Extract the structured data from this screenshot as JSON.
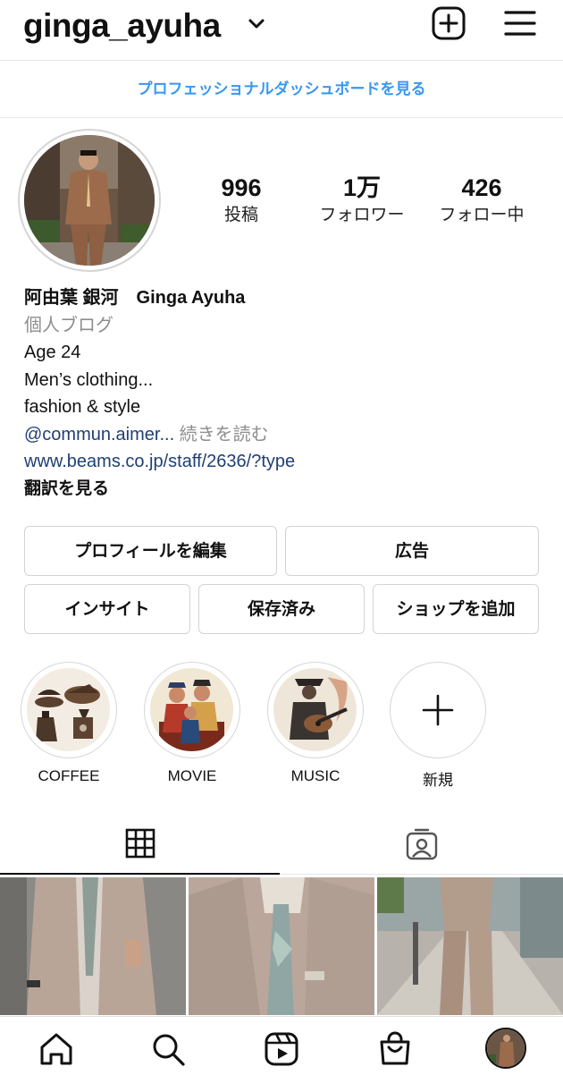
{
  "header": {
    "username": "ginga_ayuha"
  },
  "pro_dashboard_link": "プロフェッショナルダッシュボードを見る",
  "stats": [
    {
      "value": "996",
      "label": "投稿"
    },
    {
      "value": "1万",
      "label": "フォロワー"
    },
    {
      "value": "426",
      "label": "フォロー中"
    }
  ],
  "bio": {
    "name": "阿由葉 銀河　Ginga Ayuha",
    "category": "個人ブログ",
    "lines": [
      "Age 24",
      "Men’s clothing...",
      "fashion & style"
    ],
    "mention": "@commun.aimer...",
    "more": " 続きを読む",
    "url": "www.beams.co.jp/staff/2636/?type",
    "translate": "翻訳を見る"
  },
  "buttons": {
    "edit_profile": "プロフィールを編集",
    "ads": "広告",
    "insights": "インサイト",
    "saved": "保存済み",
    "add_shop": "ショップを追加"
  },
  "highlights": [
    {
      "label": "COFFEE"
    },
    {
      "label": "MOVIE"
    },
    {
      "label": "MUSIC"
    },
    {
      "label": "新規"
    }
  ],
  "colors": {
    "link_blue": "#3897f0",
    "bio_link": "#1f3f73",
    "muted": "#8e8e8e",
    "suit": "#b7a193"
  },
  "icons": {
    "header": [
      "chevron-down-icon",
      "new-post-icon",
      "menu-icon"
    ],
    "tabs": [
      "grid-icon",
      "tagged-icon"
    ],
    "nav": [
      "home-icon",
      "search-icon",
      "reels-icon",
      "shop-icon",
      "profile-avatar"
    ]
  }
}
